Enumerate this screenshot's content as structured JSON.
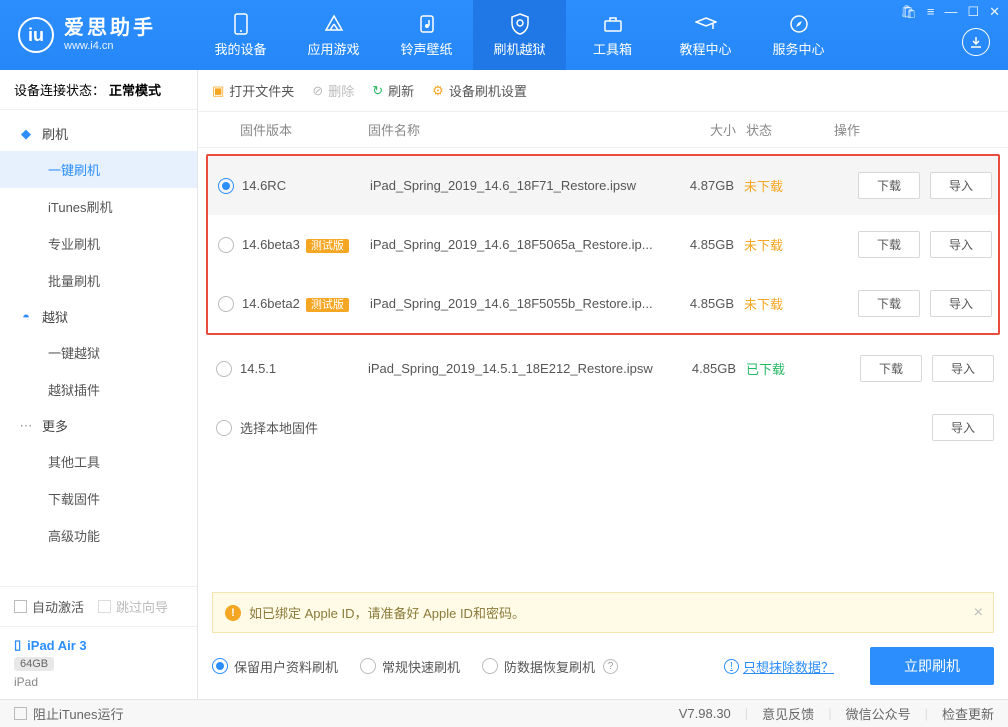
{
  "brand": "爱思助手",
  "site": "www.i4.cn",
  "nav": [
    "我的设备",
    "应用游戏",
    "铃声壁纸",
    "刷机越狱",
    "工具箱",
    "教程中心",
    "服务中心"
  ],
  "conn_label": "设备连接状态：",
  "conn_value": "正常模式",
  "sidebar": {
    "flash": {
      "head": "刷机",
      "items": [
        "一键刷机",
        "iTunes刷机",
        "专业刷机",
        "批量刷机"
      ]
    },
    "jail": {
      "head": "越狱",
      "items": [
        "一键越狱",
        "越狱插件"
      ]
    },
    "more": {
      "head": "更多",
      "items": [
        "其他工具",
        "下载固件",
        "高级功能"
      ]
    }
  },
  "auto_activate": "自动激活",
  "skip_wizard": "跳过向导",
  "device": {
    "name": "iPad Air 3",
    "storage": "64GB",
    "model": "iPad"
  },
  "toolbar": {
    "open": "打开文件夹",
    "delete": "删除",
    "refresh": "刷新",
    "settings": "设备刷机设置"
  },
  "cols": {
    "ver": "固件版本",
    "name": "固件名称",
    "size": "大小",
    "status": "状态",
    "ops": "操作"
  },
  "rows": [
    {
      "ver": "14.6RC",
      "beta": false,
      "name": "iPad_Spring_2019_14.6_18F71_Restore.ipsw",
      "size": "4.87GB",
      "status": "未下载",
      "downloaded": false,
      "selected": true
    },
    {
      "ver": "14.6beta3",
      "beta": true,
      "name": "iPad_Spring_2019_14.6_18F5065a_Restore.ip...",
      "size": "4.85GB",
      "status": "未下载",
      "downloaded": false,
      "selected": false
    },
    {
      "ver": "14.6beta2",
      "beta": true,
      "name": "iPad_Spring_2019_14.6_18F5055b_Restore.ip...",
      "size": "4.85GB",
      "status": "未下载",
      "downloaded": false,
      "selected": false
    },
    {
      "ver": "14.5.1",
      "beta": false,
      "name": "iPad_Spring_2019_14.5.1_18E212_Restore.ipsw",
      "size": "4.85GB",
      "status": "已下载",
      "downloaded": true,
      "selected": false
    }
  ],
  "beta_badge": "测试版",
  "local_fw": "选择本地固件",
  "btn_download": "下载",
  "btn_import": "导入",
  "warn": "如已绑定 Apple ID，请准备好 Apple ID和密码。",
  "modes": [
    "保留用户资料刷机",
    "常规快速刷机",
    "防数据恢复刷机"
  ],
  "erase_link": "只想抹除数据？",
  "flash_now": "立即刷机",
  "block_itunes": "阻止iTunes运行",
  "footer": {
    "version": "V7.98.30",
    "feedback": "意见反馈",
    "wechat": "微信公众号",
    "update": "检查更新"
  }
}
